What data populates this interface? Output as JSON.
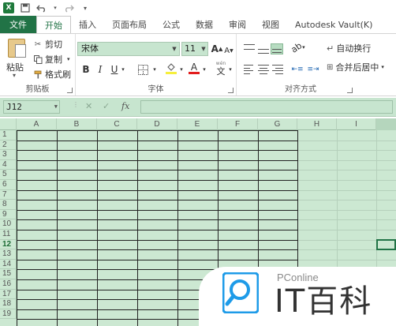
{
  "quick_access": {
    "app_icon": "excel-icon",
    "save_icon": "save-icon",
    "undo_icon": "undo-icon",
    "redo_icon": "redo-icon",
    "customize_icon": "customize-icon"
  },
  "tabs": [
    {
      "label": "文件",
      "kind": "file"
    },
    {
      "label": "开始",
      "kind": "active"
    },
    {
      "label": "插入",
      "kind": "normal"
    },
    {
      "label": "页面布局",
      "kind": "normal"
    },
    {
      "label": "公式",
      "kind": "normal"
    },
    {
      "label": "数据",
      "kind": "normal"
    },
    {
      "label": "审阅",
      "kind": "normal"
    },
    {
      "label": "视图",
      "kind": "normal"
    },
    {
      "label": "Autodesk Vault(K)",
      "kind": "normal"
    }
  ],
  "ribbon": {
    "clipboard": {
      "paste_label": "粘贴",
      "cut_label": "剪切",
      "copy_label": "复制",
      "format_painter_label": "格式刷",
      "group_label": "剪贴板"
    },
    "font": {
      "font_name": "宋体",
      "font_size": "11",
      "bold": "B",
      "italic": "I",
      "underline": "U",
      "group_label": "字体",
      "grow_label": "A",
      "shrink_label": "A",
      "phonetic_label": "文",
      "font_color_label": "A"
    },
    "alignment": {
      "wrap_label": "自动换行",
      "merge_label": "合并后居中",
      "group_label": "对齐方式"
    }
  },
  "formula_bar": {
    "name_box": "J12",
    "fx_label": "fx",
    "cancel_label": "✕",
    "confirm_label": "✓",
    "value": ""
  },
  "sheet": {
    "columns": [
      "A",
      "B",
      "C",
      "D",
      "E",
      "F",
      "G",
      "H",
      "I"
    ],
    "rows": [
      "1",
      "2",
      "3",
      "4",
      "5",
      "6",
      "7",
      "8",
      "9",
      "10",
      "11",
      "12",
      "13",
      "14",
      "15",
      "16",
      "17",
      "18",
      "19"
    ],
    "selected_row": "12",
    "active_cell": "J12"
  },
  "watermark": {
    "top_text": "PConline",
    "main_text": "IT百科"
  },
  "colors": {
    "excel_green": "#217346",
    "eye_care_green": "#cce8d2"
  }
}
